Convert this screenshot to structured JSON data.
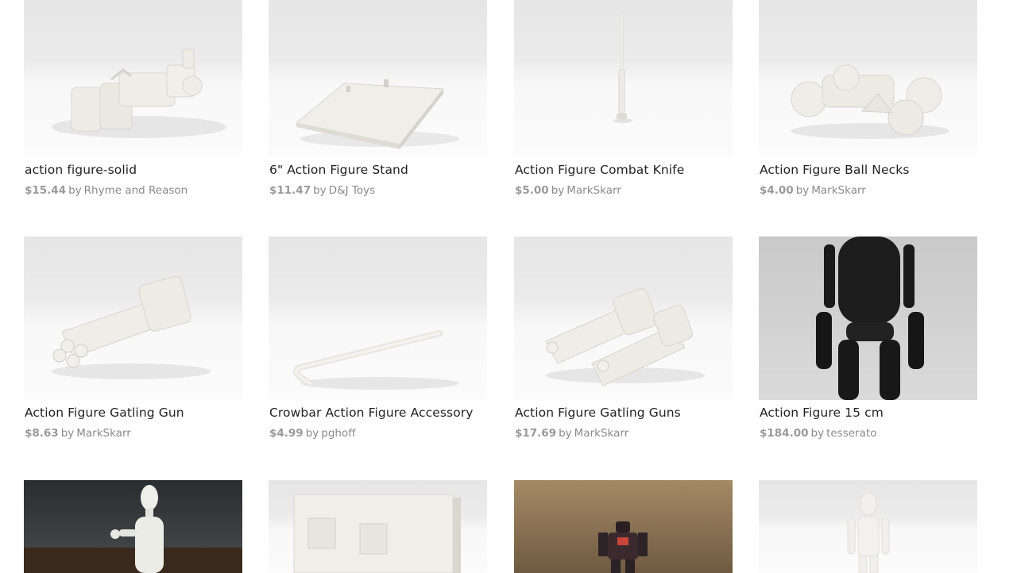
{
  "products": [
    {
      "title": "action figure-solid",
      "price": "$15.44",
      "by": "by",
      "seller": "Rhyme and Reason",
      "image": "solid-figure-render"
    },
    {
      "title": "6\" Action Figure Stand",
      "price": "$11.47",
      "by": "by",
      "seller": "D&J Toys",
      "image": "stand-render"
    },
    {
      "title": "Action Figure Combat Knife",
      "price": "$5.00",
      "by": "by",
      "seller": "MarkSkarr",
      "image": "knife-render"
    },
    {
      "title": "Action Figure Ball Necks",
      "price": "$4.00",
      "by": "by",
      "seller": "MarkSkarr",
      "image": "ball-necks-render"
    },
    {
      "title": "Action Figure Gatling Gun",
      "price": "$8.63",
      "by": "by",
      "seller": "MarkSkarr",
      "image": "gatling-gun-render"
    },
    {
      "title": "Crowbar Action Figure Accessory",
      "price": "$4.99",
      "by": "by",
      "seller": "pghoff",
      "image": "crowbar-render"
    },
    {
      "title": "Action Figure Gatling Guns",
      "price": "$17.69",
      "by": "by",
      "seller": "MarkSkarr",
      "image": "gatling-guns-render"
    },
    {
      "title": "Action Figure 15 cm",
      "price": "$184.00",
      "by": "by",
      "seller": "tesserato",
      "image": "black-figure-photo"
    },
    {
      "image": "wooden-mannequin-photo"
    },
    {
      "image": "cube-render"
    },
    {
      "image": "robot-figure-photo"
    },
    {
      "image": "white-figure-render"
    }
  ]
}
